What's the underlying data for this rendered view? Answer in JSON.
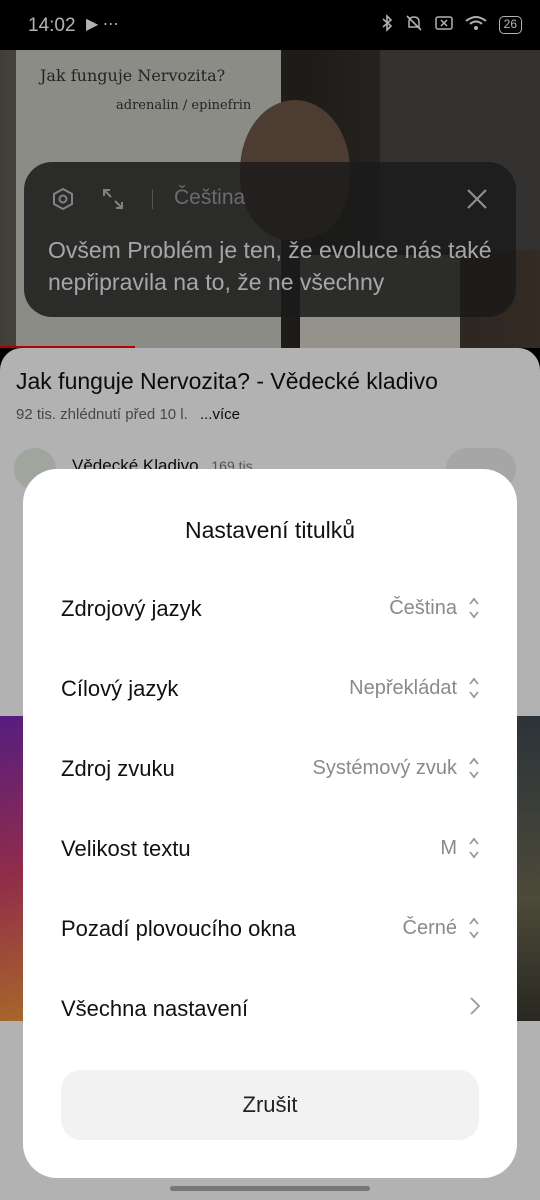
{
  "status_bar": {
    "time": "14:02",
    "left_icons": "▶ ⋯",
    "battery": "26"
  },
  "whiteboard": {
    "line1": "Jak funguje Nervozita?",
    "line2": "adrenalin / epinefrin"
  },
  "caption_window": {
    "language": "Čeština",
    "text": "Ovšem Problém je ten, že evoluce nás také nepřipravila na to, že ne všechny"
  },
  "video": {
    "title": "Jak funguje Nervozita? - Vědecké kladivo",
    "views": "92 tis. zhlédnutí",
    "age": "před 10 l.",
    "more": "...více",
    "channel": "Vědecké Kladivo",
    "subs": "169 tis."
  },
  "settings_sheet": {
    "title": "Nastavení titulků",
    "rows": [
      {
        "label": "Zdrojový jazyk",
        "value": "Čeština"
      },
      {
        "label": "Cílový jazyk",
        "value": "Nepřekládat"
      },
      {
        "label": "Zdroj zvuku",
        "value": "Systémový zvuk"
      },
      {
        "label": "Velikost textu",
        "value": "M"
      },
      {
        "label": "Pozadí plovoucího okna",
        "value": "Černé"
      },
      {
        "label": "Všechna nastavení",
        "value": ""
      }
    ],
    "cancel": "Zrušit"
  }
}
